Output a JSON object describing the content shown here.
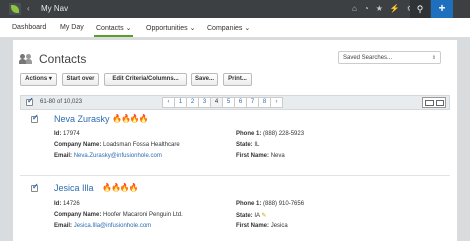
{
  "app": {
    "title": "My Nav",
    "nav_caret": "‹",
    "top_icons": [
      "⌂",
      "◔",
      "★",
      "⚡",
      "⚙"
    ],
    "search_glyph": "⚲",
    "add_glyph": "+"
  },
  "nav": {
    "items": [
      {
        "label": "Dashboard"
      },
      {
        "label": "My Day"
      },
      {
        "label": "Contacts ⌄"
      },
      {
        "label": "Opportunities ⌄"
      },
      {
        "label": "Companies ⌄"
      }
    ]
  },
  "page": {
    "title": "Contacts",
    "saved_searches": "Saved Searches..."
  },
  "toolbar": {
    "actions": "Actions ▾",
    "start_over": "Start over",
    "edit_criteria": "Edit Criteria/Columns...",
    "save": "Save...",
    "print": "Print..."
  },
  "list": {
    "range": "61-80 of 10,023",
    "pages": [
      "‹",
      "1",
      "2",
      "3",
      "4",
      "5",
      "6",
      "7",
      "8",
      "›"
    ],
    "current_page": "4"
  },
  "records": [
    {
      "name": "Neva Zurasky",
      "flames": "🔥🔥🔥🔥",
      "id_label": "Id:",
      "id": "17974",
      "company_label": "Company Name:",
      "company": "Loadsman Fossa Healthcare",
      "email_label": "Email:",
      "email": "Neva.Zurasky@infusionhole.com",
      "phone_label": "Phone 1:",
      "phone": "(888) 228-5923",
      "state_label": "State:",
      "state": "IL",
      "first_label": "First Name:",
      "first": "Neva"
    },
    {
      "name": "Jesica Illa",
      "flames": "🔥🔥🔥🔥",
      "id_label": "Id:",
      "id": "14726",
      "company_label": "Company Name:",
      "company": "Hoofer Macaroni Penguin Ltd.",
      "email_label": "Email:",
      "email": "Jesica.Illa@infusionhole.com",
      "phone_label": "Phone 1:",
      "phone": "(888) 910-7656",
      "state_label": "State:",
      "state": "IA",
      "first_label": "First Name:",
      "first": "Jesica"
    }
  ],
  "colors": {
    "topbar": "#3c4043",
    "accent_blue": "#1f6fbf",
    "link": "#2c6cb0",
    "active_tab": "#5a9e2f",
    "flame": "#e8731a"
  }
}
